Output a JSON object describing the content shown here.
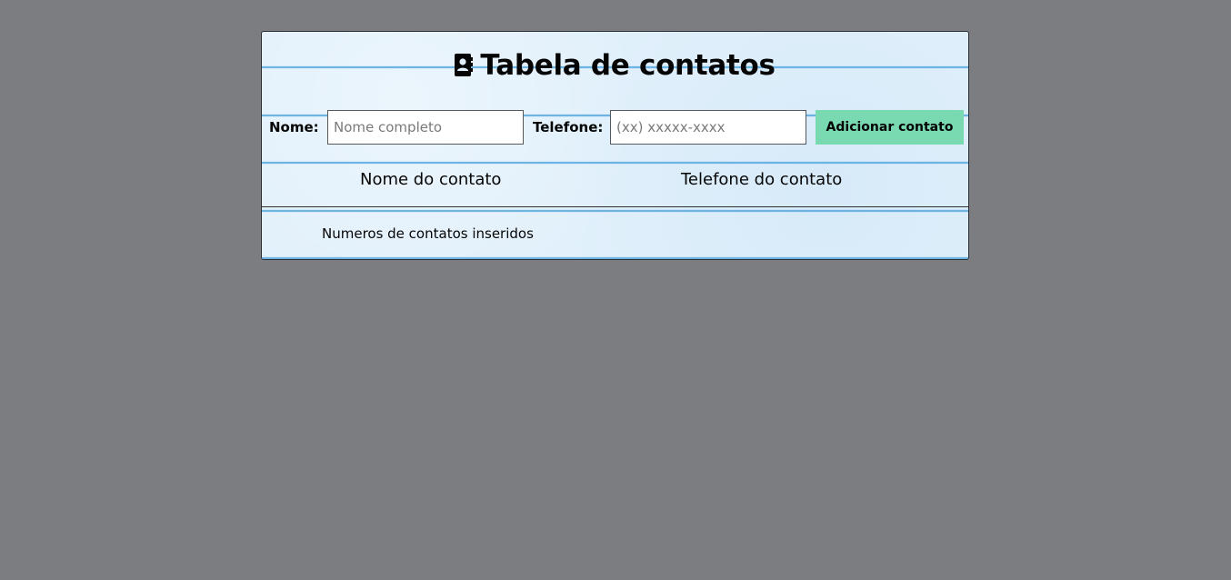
{
  "header": {
    "icon": "address-book-icon",
    "title": "Tabela de contatos"
  },
  "form": {
    "name_label": "Nome:",
    "name_placeholder": "Nome completo",
    "name_value": "",
    "phone_label": "Telefone:",
    "phone_placeholder": "(xx) xxxxx-xxxx",
    "phone_value": "",
    "add_button_label": "Adicionar contato"
  },
  "table": {
    "columns": [
      "Nome do contato",
      "Telefone do contato"
    ],
    "rows": [],
    "footer_label": "Numeros de contatos inseridos",
    "footer_value": ""
  },
  "colors": {
    "background": "#7c7d81",
    "paper": "#e1f0fb",
    "ruled_lines": "#46a0dc",
    "button": "#79d9b1"
  }
}
